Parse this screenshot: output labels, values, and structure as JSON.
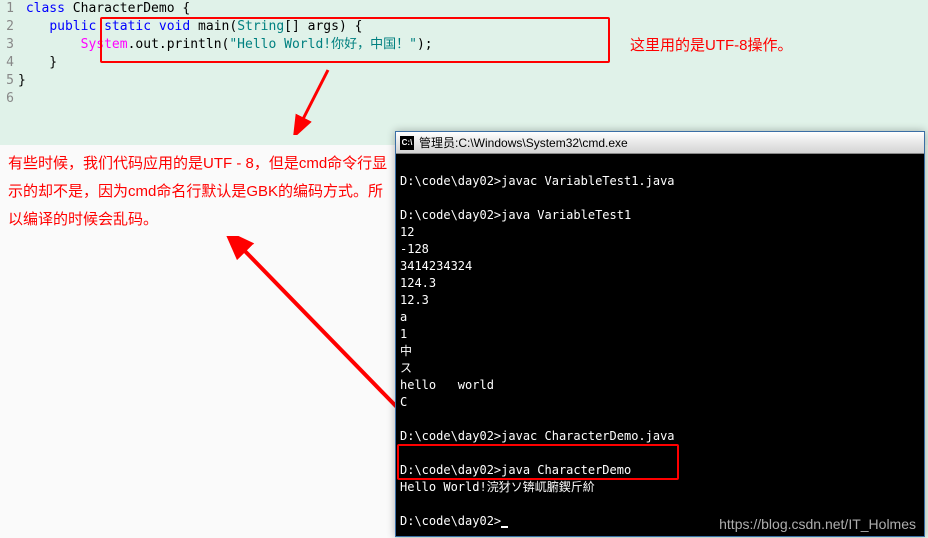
{
  "code": {
    "line_numbers": [
      "1",
      "2",
      "3",
      "4",
      "5",
      "6"
    ],
    "line1": {
      "kw_class": "class",
      "name": " CharacterDemo {"
    },
    "line2": {
      "indent": "    ",
      "kw_public": "public",
      "sp": " ",
      "kw_static": "static",
      "sp2": " ",
      "kw_void": "void",
      "sp3": " ",
      "main": "main(",
      "type": "String",
      "rest": "[] args) {"
    },
    "line3": {
      "indent": "        ",
      "sys": "System",
      "dot_out": ".out.",
      "println": "println(",
      "str": "\"Hello World!你好，中国！\"",
      "end": ");"
    },
    "line4": "    }",
    "line5": "}"
  },
  "annotations": {
    "right": "这里用的是UTF-8操作。",
    "left": "有些时候，我们代码应用的是UTF - 8，但是cmd命令行显示的却不是，因为cmd命名行默认是GBK的编码方式。所以编译的时候会乱码。"
  },
  "cmd": {
    "title_prefix": "管理员: ",
    "title_path": "C:\\Windows\\System32\\cmd.exe",
    "lines": [
      "D:\\code\\day02>javac VariableTest1.java",
      "",
      "D:\\code\\day02>java VariableTest1",
      "12",
      "-128",
      "3414234324",
      "124.3",
      "12.3",
      "a",
      "1",
      "中",
      "ス",
      "hello   world",
      "C",
      "",
      "D:\\code\\day02>javac CharacterDemo.java",
      "",
      "D:\\code\\day02>java CharacterDemo",
      "Hello World!浣犲ソ锛屼腑鍥斤紒",
      "",
      "D:\\code\\day02>"
    ]
  },
  "watermark": "https://blog.csdn.net/IT_Holmes"
}
